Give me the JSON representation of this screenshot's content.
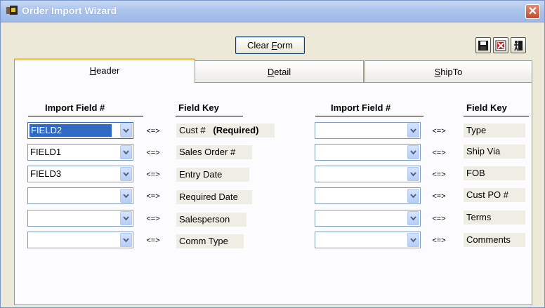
{
  "window": {
    "title": "Order Import Wizard",
    "close_label": "✕"
  },
  "toolbar": {
    "clear_label_prefix": "Clear ",
    "clear_label_u": "F",
    "clear_label_suffix": "orm"
  },
  "tabs": [
    {
      "prefix": "",
      "u": "H",
      "suffix": "eader"
    },
    {
      "prefix": "",
      "u": "D",
      "suffix": "etail"
    },
    {
      "prefix": "",
      "u": "S",
      "suffix": "hipTo"
    }
  ],
  "headers": {
    "import_field": "Import Field #",
    "field_key": "Field Key"
  },
  "mapping_arrow": "<=>",
  "left_rows": [
    {
      "value": "FIELD2",
      "key": "Cust #",
      "note": "(Required)"
    },
    {
      "value": "FIELD1",
      "key": "Sales Order #"
    },
    {
      "value": "FIELD3",
      "key": "Entry Date"
    },
    {
      "value": "",
      "key": "Required Date"
    },
    {
      "value": "",
      "key": "Salesperson"
    },
    {
      "value": "",
      "key": "Comm Type"
    }
  ],
  "right_rows": [
    {
      "value": "",
      "key": "Type"
    },
    {
      "value": "",
      "key": "Ship Via"
    },
    {
      "value": "",
      "key": "FOB"
    },
    {
      "value": "",
      "key": "Cust PO #"
    },
    {
      "value": "",
      "key": "Terms"
    },
    {
      "value": "",
      "key": "Comments"
    }
  ]
}
